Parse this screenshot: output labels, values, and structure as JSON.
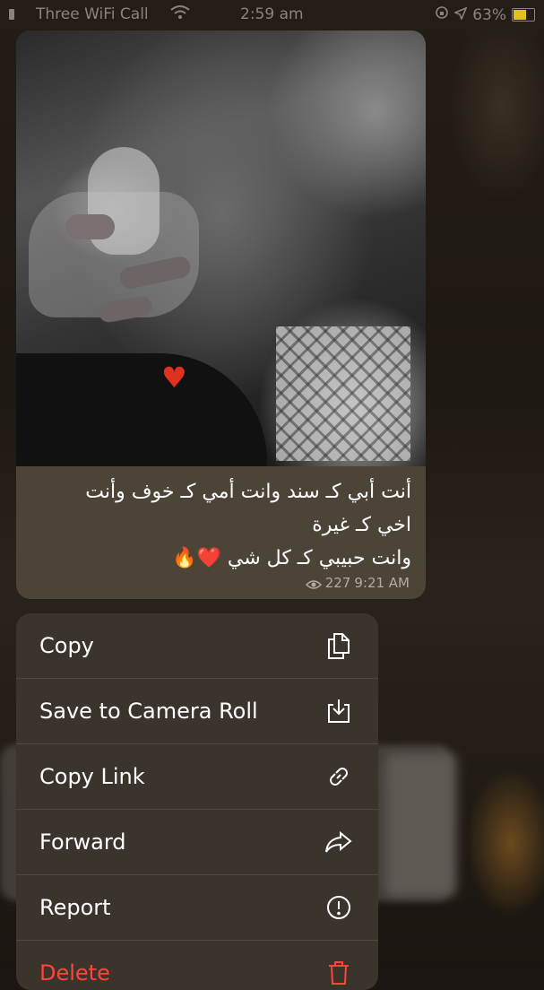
{
  "status_bar": {
    "carrier": "Three WiFi Call",
    "time": "2:59 am",
    "battery": "63%",
    "battery_level": 0.63,
    "icons": [
      "wifi-icon",
      "lock-rotation-icon",
      "location-icon",
      "battery-icon"
    ]
  },
  "message": {
    "caption_lines": [
      "أنت أبي كـ سند وانت أمي كـ خوف وأنت",
      "اخي كـ غيرة",
      "وانت حبيبي كـ كل شي ❤️🔥"
    ],
    "views": "227",
    "time": "9:21 AM"
  },
  "menu": {
    "items": [
      {
        "label": "Copy",
        "icon": "copy-icon"
      },
      {
        "label": "Save to Camera Roll",
        "icon": "save-download-icon"
      },
      {
        "label": "Copy Link",
        "icon": "link-icon"
      },
      {
        "label": "Forward",
        "icon": "forward-icon"
      },
      {
        "label": "Report",
        "icon": "report-icon"
      },
      {
        "label": "Delete",
        "icon": "trash-icon",
        "color": "#ff453a"
      }
    ]
  },
  "colors": {
    "background": "#1c1712",
    "bubble": "#4d4438",
    "menu": "#3b342c",
    "danger": "#ff453a",
    "battery": "#e0c020"
  }
}
